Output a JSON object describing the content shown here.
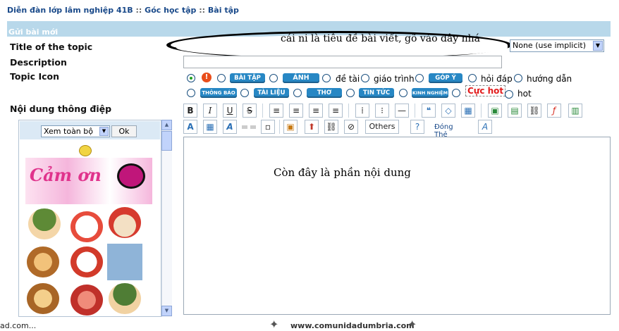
{
  "breadcrumb": {
    "items": [
      "Diễn đàn lớp lâm nghiệp 41B",
      "Góc học tập",
      "Bài tập"
    ],
    "separator": "::"
  },
  "form": {
    "section_title": "Gửi bài mới",
    "title_label": "Title of the topic",
    "title_value": "cái ni là tiêu đề bài viết, gõ vào đây nhá",
    "prefix_select": "None (use implicit)",
    "description_label": "Description",
    "description_value": "",
    "icon_label": "Topic Icon",
    "content_label": "Nội dung thông điệp",
    "content_value": "Còn đây là phần nội dung"
  },
  "topic_icons": {
    "row1": [
      {
        "type": "red-circle",
        "text": "!"
      },
      {
        "type": "badge",
        "text": "BÀI TẬP"
      },
      {
        "type": "badge",
        "text": "ẢNH"
      },
      {
        "type": "text",
        "text": "đề tài"
      },
      {
        "type": "text",
        "text": "giáo trình"
      },
      {
        "type": "badge",
        "text": "GÓP Ý"
      },
      {
        "type": "text",
        "text": "hỏi đáp"
      },
      {
        "type": "text",
        "text": "hướng dẫn"
      }
    ],
    "row2": [
      {
        "type": "badge",
        "text": "THÔNG BÁO"
      },
      {
        "type": "badge",
        "text": "TÀI LIỆU"
      },
      {
        "type": "badge",
        "text": "THƠ"
      },
      {
        "type": "badge",
        "text": "TIN TỨC"
      },
      {
        "type": "badge",
        "text": "KINH NGHIỆM"
      },
      {
        "type": "hot",
        "text": "Cực hot"
      },
      {
        "type": "text",
        "text": "hot"
      }
    ]
  },
  "toolbar": {
    "row1": [
      "bold-icon",
      "italic-icon",
      "underline-icon",
      "strikethrough-icon",
      "align-left-icon",
      "align-center-icon",
      "align-right-icon",
      "justify-icon",
      "ordered-list-icon",
      "unordered-list-icon",
      "horizontal-rule-icon",
      "quote-icon",
      "code-icon",
      "table-icon",
      "image-icon",
      "picture-icon",
      "link-icon",
      "flash-icon",
      "video-icon"
    ],
    "row1_glyphs": [
      "B",
      "I",
      "U",
      "S",
      "≡",
      "≡",
      "≡",
      "≡",
      "⁞",
      "⁝",
      "—",
      "❝",
      "◇",
      "▦",
      "▣",
      "▤",
      "⛓",
      "ƒ",
      "▥"
    ],
    "others_label": "Others",
    "close_tags_label": "Đóng Thẻ"
  },
  "smiley_panel": {
    "view_select": "Xem toàn bộ",
    "ok_label": "Ok",
    "banner_text": "Cảm ơn"
  },
  "footer": {
    "left": "ad.com...",
    "right": "www.comunidadumbria.com"
  }
}
